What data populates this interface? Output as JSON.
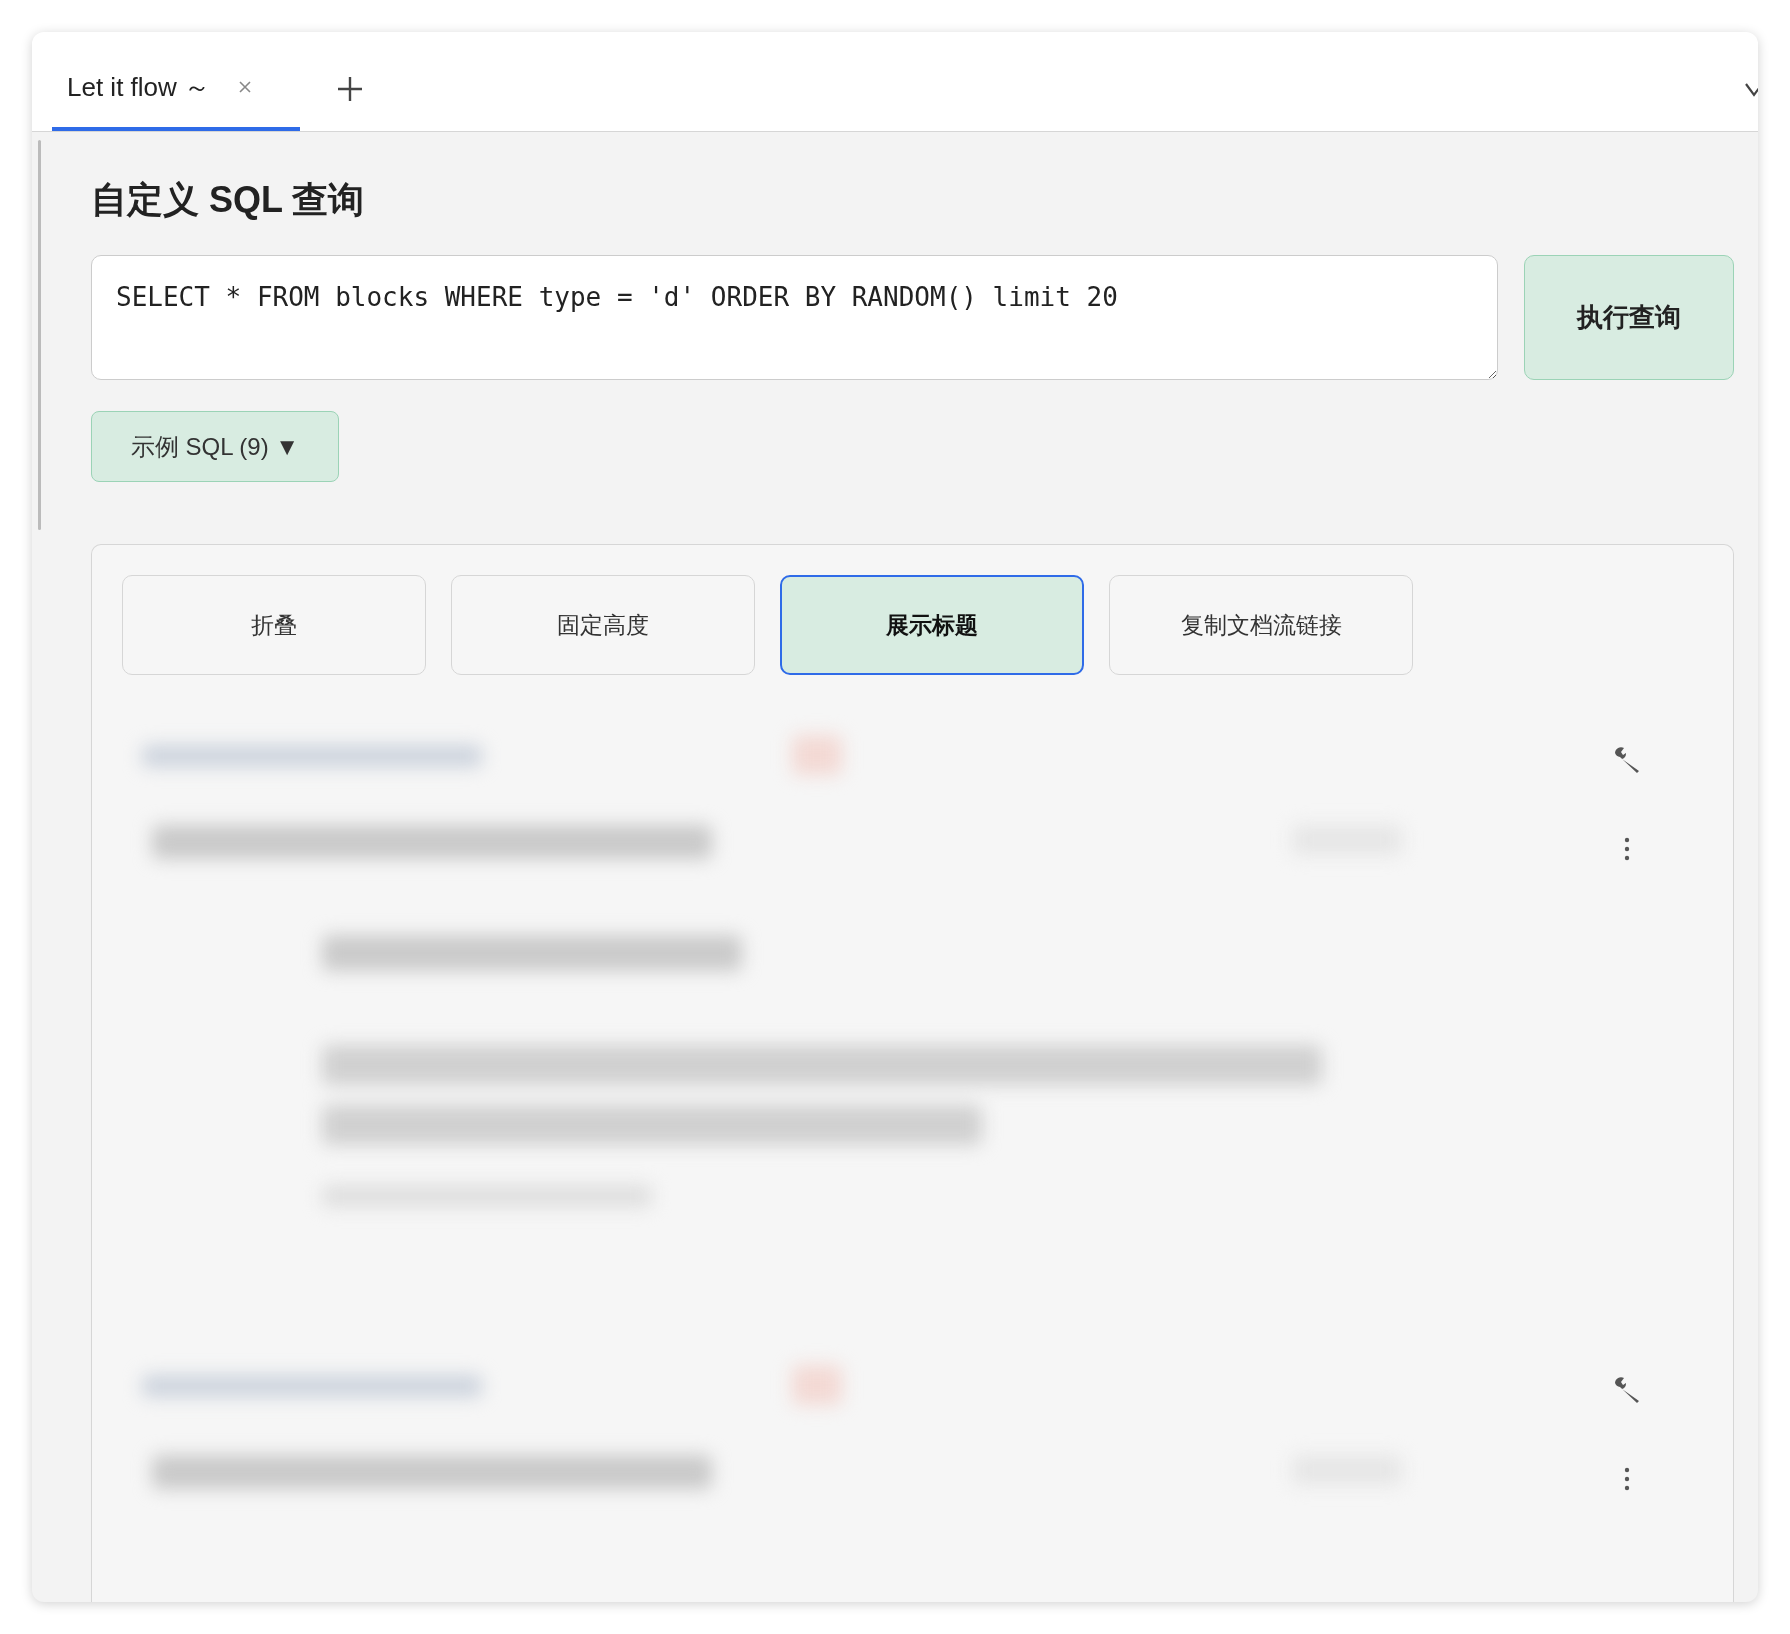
{
  "tabs": [
    {
      "label": "Let it flow ～",
      "selected": true
    }
  ],
  "query": {
    "title": "自定义 SQL 查询",
    "value": "SELECT * FROM blocks WHERE type = 'd' ORDER BY RANDOM() limit 20",
    "run_button": "执行查询",
    "examples_button": "示例 SQL (9) ▼"
  },
  "options": [
    {
      "label": "折叠",
      "selected": false
    },
    {
      "label": "固定高度",
      "selected": false
    },
    {
      "label": "展示标题",
      "selected": true
    },
    {
      "label": "复制文档流链接",
      "selected": false
    }
  ],
  "results": [
    {
      "kind": "long"
    },
    {
      "kind": "short"
    }
  ]
}
